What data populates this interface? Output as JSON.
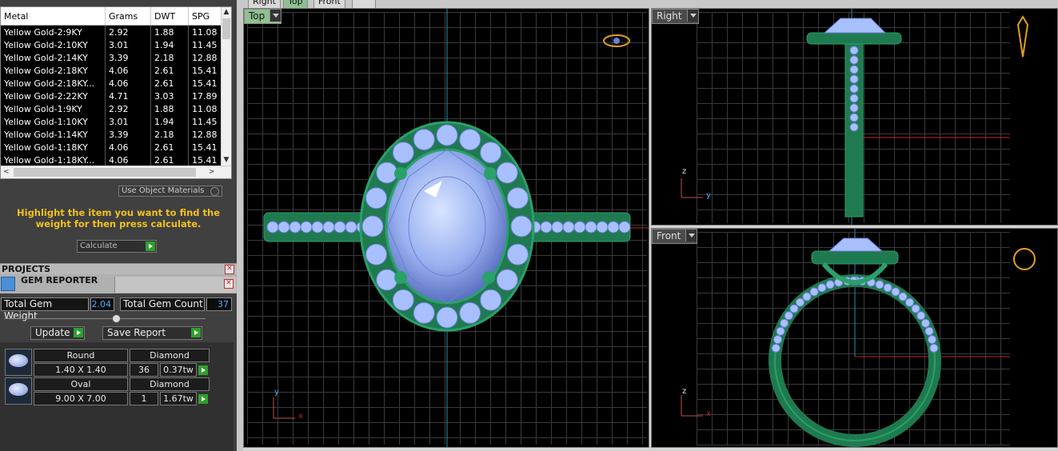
{
  "metal_table": {
    "headers": [
      "Metal",
      "Grams",
      "DWT",
      "SPG"
    ],
    "rows": [
      [
        "Yellow Gold-2:9KY",
        "2.92",
        "1.88",
        "11.08"
      ],
      [
        "Yellow Gold-2:10KY",
        "3.01",
        "1.94",
        "11.45"
      ],
      [
        "Yellow Gold-2:14KY",
        "3.39",
        "2.18",
        "12.88"
      ],
      [
        "Yellow Gold-2:18KY",
        "4.06",
        "2.61",
        "15.41"
      ],
      [
        "Yellow Gold-2:18KY...",
        "4.06",
        "2.61",
        "15.41"
      ],
      [
        "Yellow Gold-2:22KY",
        "4.71",
        "3.03",
        "17.89"
      ],
      [
        "Yellow Gold-1:9KY",
        "2.92",
        "1.88",
        "11.08"
      ],
      [
        "Yellow Gold-1:10KY",
        "3.01",
        "1.94",
        "11.45"
      ],
      [
        "Yellow Gold-1:14KY",
        "3.39",
        "2.18",
        "12.88"
      ],
      [
        "Yellow Gold-1:18KY",
        "4.06",
        "2.61",
        "15.41"
      ],
      [
        "Yellow Gold-1:18KY...",
        "4.06",
        "2.61",
        "15.41"
      ]
    ]
  },
  "weight_tool": {
    "use_object_materials_label": "Use Object Materials",
    "hint_text": "Highlight the item you want to find the weight for then press calculate.",
    "calculate_label": "Calculate"
  },
  "projects": {
    "title": "PROJECTS"
  },
  "gem_reporter": {
    "title": "GEM REPORTER",
    "total_weight_label": "Total Gem Weight",
    "total_weight_value": "2.04",
    "total_count_label": "Total Gem Count",
    "total_count_value": "37",
    "update_label": "Update",
    "save_report_label": "Save Report",
    "gems": [
      {
        "shape": "Round",
        "material": "Diamond",
        "size": "1.40 X 1.40",
        "count": "36",
        "weight": "0.37tw"
      },
      {
        "shape": "Oval",
        "material": "Diamond",
        "size": "9.00 X 7.00",
        "count": "1",
        "weight": "1.67tw"
      }
    ]
  },
  "top_tabs": [
    "Right",
    "Top",
    "Front"
  ],
  "viewports": {
    "top": {
      "label": "Top",
      "axis_y": "y",
      "axis_x": "x"
    },
    "right": {
      "label": "Right",
      "axis_z": "z",
      "axis_y": "y"
    },
    "front": {
      "label": "Front",
      "axis_z": "z",
      "axis_x": "x"
    }
  },
  "colors": {
    "metal_green": "#2aa06a",
    "gem_blue": "#a8c0ff",
    "axis_red": "#c02020",
    "axis_cyan": "#2a8fa8",
    "hint_yellow": "#f0c020",
    "value_blue": "#4fa8ff"
  }
}
